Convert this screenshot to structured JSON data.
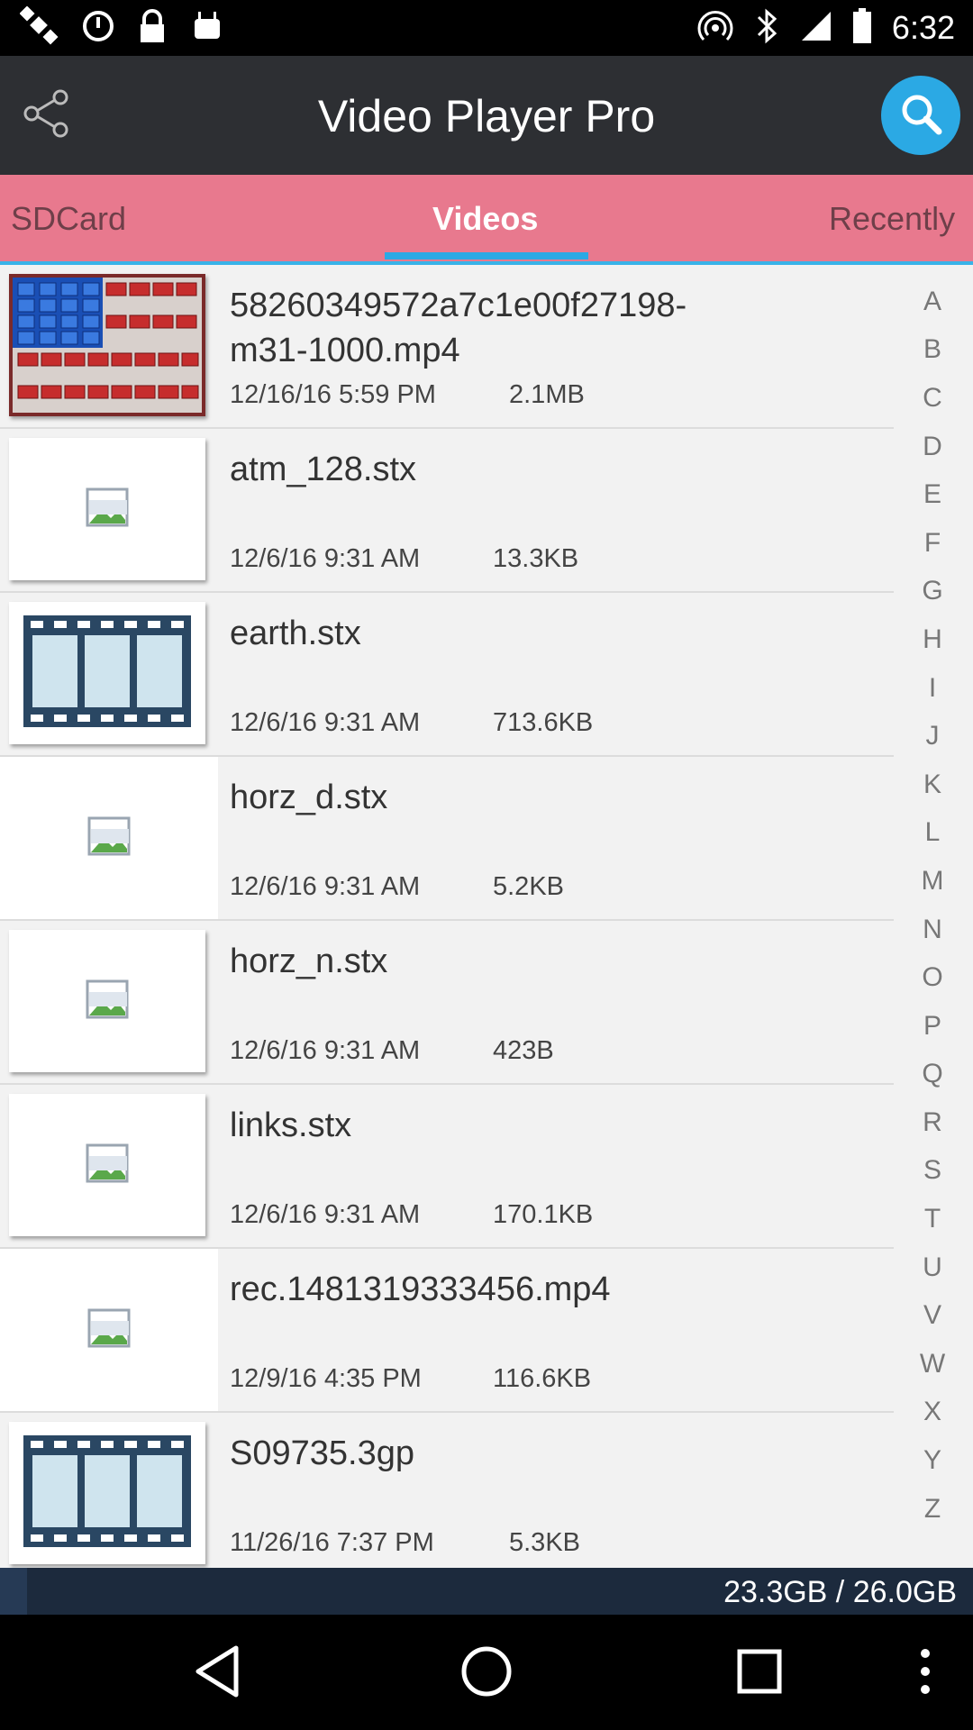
{
  "status_bar": {
    "time": "6:32",
    "left_icons": [
      "satellite-fake-gps-icon",
      "alarm-icon",
      "lock-icon",
      "android-icon"
    ],
    "right_icons": [
      "hotspot-icon",
      "bluetooth-icon",
      "cellular-signal-icon",
      "battery-icon"
    ]
  },
  "header": {
    "title": "Video Player Pro",
    "share_icon": "share-icon",
    "search_icon": "search-icon",
    "accent": "#2ba9e4"
  },
  "tabs": [
    {
      "label": "SDCard",
      "active": false
    },
    {
      "label": "Videos",
      "active": true
    },
    {
      "label": "Recently",
      "active": false
    }
  ],
  "files": [
    {
      "name": "58260349572a7c1e00f27198-m31-1000.mp4",
      "date": "12/16/16 5:59 PM",
      "size": "2.1MB",
      "thumb": "flag"
    },
    {
      "name": "atm_128.stx",
      "date": "12/6/16 9:31 AM",
      "size": "13.3KB",
      "thumb": "broken"
    },
    {
      "name": "earth.stx",
      "date": "12/6/16 9:31 AM",
      "size": "713.6KB",
      "thumb": "film"
    },
    {
      "name": "horz_d.stx",
      "date": "12/6/16 9:31 AM",
      "size": "5.2KB",
      "thumb": "broken-plain"
    },
    {
      "name": "horz_n.stx",
      "date": "12/6/16 9:31 AM",
      "size": "423B",
      "thumb": "broken"
    },
    {
      "name": "links.stx",
      "date": "12/6/16 9:31 AM",
      "size": "170.1KB",
      "thumb": "broken"
    },
    {
      "name": "rec.1481319333456.mp4",
      "date": "12/9/16 4:35 PM",
      "size": "116.6KB",
      "thumb": "broken-plain"
    },
    {
      "name": "S09735.3gp",
      "date": "11/26/16 7:37 PM",
      "size": "5.3KB",
      "thumb": "film"
    }
  ],
  "alphabet": [
    "A",
    "B",
    "C",
    "D",
    "E",
    "F",
    "G",
    "H",
    "I",
    "J",
    "K",
    "L",
    "M",
    "N",
    "O",
    "P",
    "Q",
    "R",
    "S",
    "T",
    "U",
    "V",
    "W",
    "X",
    "Y",
    "Z"
  ],
  "storage": {
    "text": "23.3GB / 26.0GB"
  },
  "nav": {
    "back_icon": "back-icon",
    "home_icon": "home-icon",
    "recents_icon": "recents-icon",
    "menu_icon": "overflow-menu-icon"
  }
}
